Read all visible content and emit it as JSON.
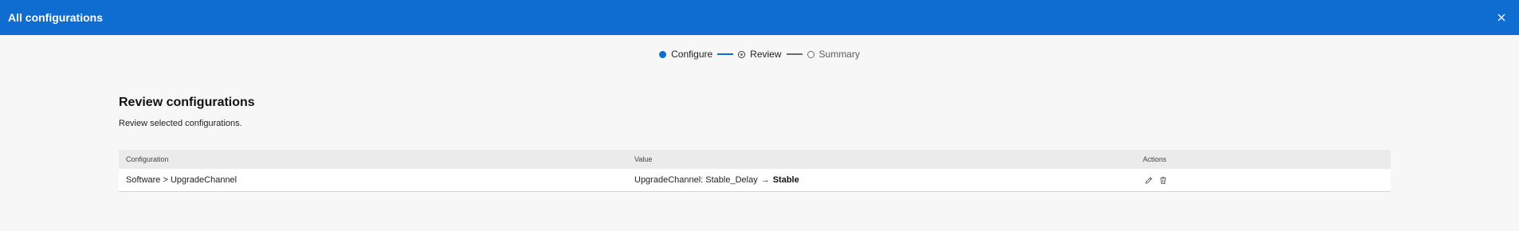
{
  "window": {
    "title": "All configurations",
    "close_icon": "close-icon"
  },
  "stepper": {
    "steps": [
      {
        "label": "Configure",
        "state": "done"
      },
      {
        "label": "Review",
        "state": "current"
      },
      {
        "label": "Summary",
        "state": "todo"
      }
    ]
  },
  "page": {
    "heading": "Review configurations",
    "subheading": "Review selected configurations."
  },
  "table": {
    "headers": {
      "configuration": "Configuration",
      "value": "Value",
      "actions": "Actions"
    },
    "rows": [
      {
        "configuration": "Software > UpgradeChannel",
        "value_prefix": "UpgradeChannel: Stable_Delay",
        "arrow": "→",
        "value_new": "Stable",
        "actions": [
          "edit-icon",
          "delete-icon"
        ]
      }
    ]
  },
  "colors": {
    "accent": "#0f6cd1",
    "background": "#f7f7f7",
    "header_row": "#ebebeb"
  }
}
